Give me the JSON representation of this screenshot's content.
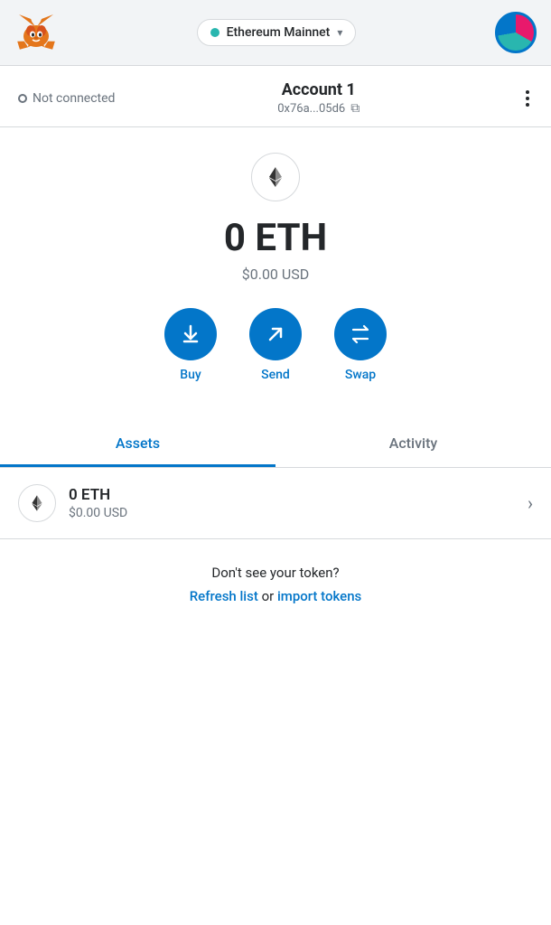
{
  "header": {
    "network_name": "Ethereum Mainnet",
    "network_dot_color": "#29b6af"
  },
  "account_bar": {
    "not_connected_label": "Not connected",
    "account_name": "Account 1",
    "account_address": "0x76a...05d6",
    "more_menu_label": "⋮"
  },
  "balance": {
    "eth_amount": "0 ETH",
    "usd_amount": "$0.00 USD"
  },
  "actions": {
    "buy_label": "Buy",
    "send_label": "Send",
    "swap_label": "Swap"
  },
  "tabs": {
    "assets_label": "Assets",
    "activity_label": "Activity"
  },
  "assets": [
    {
      "name": "0 ETH",
      "usd": "$0.00 USD"
    }
  ],
  "token_section": {
    "question": "Don't see your token?",
    "refresh_label": "Refresh list",
    "or_text": " or ",
    "import_label": "import tokens"
  }
}
